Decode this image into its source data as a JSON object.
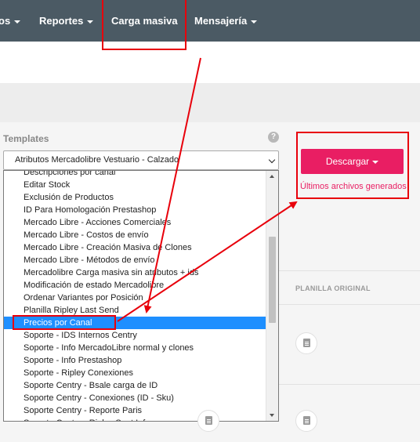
{
  "nav": {
    "items": [
      {
        "label": "os",
        "caret": true
      },
      {
        "label": "Reportes",
        "caret": true
      },
      {
        "label": "Carga masiva",
        "caret": false
      },
      {
        "label": "Mensajería",
        "caret": true
      }
    ]
  },
  "form": {
    "templates_label": "Templates",
    "help_glyph": "?",
    "selected_template": "Atributos Mercadolibre Vestuario - Calzado"
  },
  "dropdown": {
    "selected_option": "Precios por Canal",
    "options": [
      "Descripciones por canal",
      "Editar Stock",
      "Exclusión de Productos",
      "ID Para Homologación Prestashop",
      "Mercado Libre - Acciones Comerciales",
      "Mercado Libre - Costos de envío",
      "Mercado Libre - Creación Masiva de Clones",
      "Mercado Libre - Métodos de envío",
      "Mercadolibre Carga masiva sin atributos + ids",
      "Modificación de estado Mercadolibre",
      "Ordenar Variantes por Posición",
      "Planilla Ripley Last Send",
      "Precios por Canal",
      "Soporte - IDS Internos Centry",
      "Soporte - Info MercadoLibre normal y clones",
      "Soporte - Info Prestashop",
      "Soporte - Ripley Conexiones",
      "Soporte Centry - Bsale carga de ID",
      "Soporte Centry - Conexiones (ID - Sku)",
      "Soporte Centry - Reporte Paris",
      "Soporte Centry - Ripley Sent Info"
    ]
  },
  "actions": {
    "download_label": "Descargar",
    "recent_files_label": "Últimos archivos generados"
  },
  "table": {
    "planilla_header": "PLANILLA ORIGINAL"
  },
  "icons": {
    "help": "question-circle-icon",
    "document": "document-icon",
    "chevron": "chevron-down-icon"
  },
  "colors": {
    "nav_bg": "#4b5a64",
    "accent": "#e91e63",
    "selection": "#1e8fff",
    "annotation": "#e8000b"
  }
}
